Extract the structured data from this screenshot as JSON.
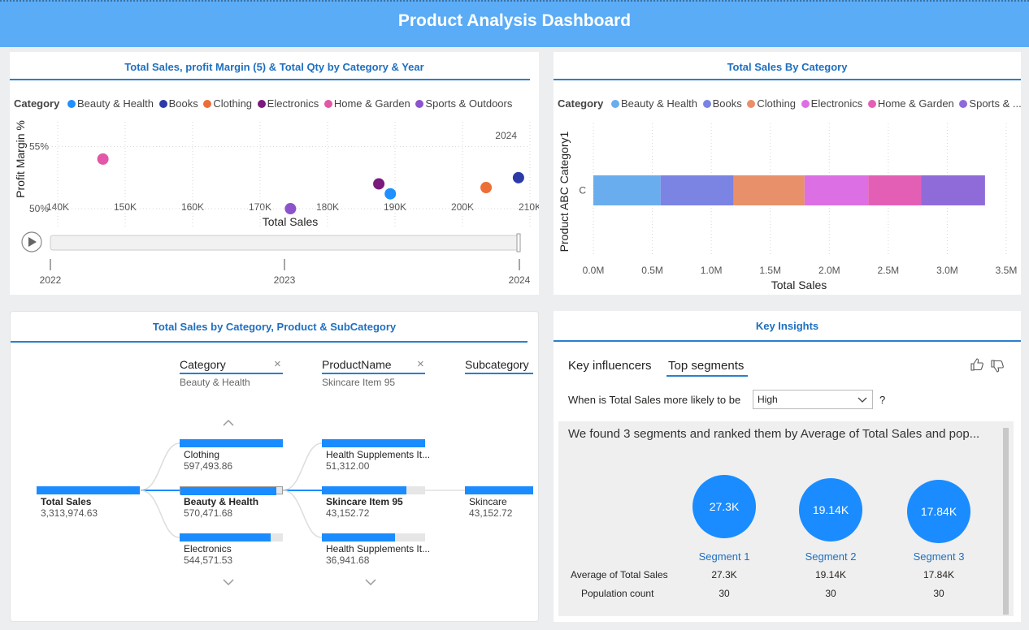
{
  "dashboard": {
    "title": "Product Analysis Dashboard"
  },
  "colors": {
    "header": "#5aacf7",
    "accent": "#1a8cff",
    "beauty_health": "#6aadee",
    "books": "#7b83e3",
    "clothing": "#e8906a",
    "electronics": "#dc6fe3",
    "home_garden": "#e35fb5",
    "sports_outdoors": "#8f6bda",
    "scatter_beauty": "#1e90ff",
    "scatter_books": "#2c3aa8",
    "scatter_clothing": "#ec6f37",
    "scatter_electronics": "#7b1a7d",
    "scatter_home": "#e357a8",
    "scatter_sports": "#8c53cc"
  },
  "scatter_panel": {
    "title": "Total Sales, profit Margin (5) & Total Qty by Category & Year",
    "legend_title": "Category",
    "legend": [
      {
        "label": "Beauty & Health",
        "color": "#1e90ff"
      },
      {
        "label": "Books",
        "color": "#2c3aa8"
      },
      {
        "label": "Clothing",
        "color": "#ec6f37"
      },
      {
        "label": "Electronics",
        "color": "#7b1a7d"
      },
      {
        "label": "Home & Garden",
        "color": "#e357a8"
      },
      {
        "label": "Sports & Outdoors",
        "color": "#8c53cc"
      }
    ],
    "play_axis": {
      "years": [
        "2022",
        "2023",
        "2024"
      ],
      "current": "2024"
    }
  },
  "bar_panel": {
    "title": "Total Sales By Category",
    "legend_title": "Category",
    "legend": [
      {
        "label": "Beauty & Health",
        "color": "#6aadee"
      },
      {
        "label": "Books",
        "color": "#7b83e3"
      },
      {
        "label": "Clothing",
        "color": "#e8906a"
      },
      {
        "label": "Electronics",
        "color": "#dc6fe3"
      },
      {
        "label": "Home & Garden",
        "color": "#e35fb5"
      },
      {
        "label": "Sports & ...",
        "color": "#8f6bda"
      }
    ]
  },
  "chart_data": [
    {
      "type": "scatter",
      "title": "",
      "frame_label": "2024",
      "xlabel": "Total Sales",
      "ylabel": "Profit Margin %",
      "xlim": [
        140000,
        210000
      ],
      "ylim": [
        48.5,
        57
      ],
      "x_ticks": [
        "140K",
        "150K",
        "160K",
        "170K",
        "180K",
        "190K",
        "200K",
        "210K"
      ],
      "x_tick_values": [
        140000,
        150000,
        160000,
        170000,
        180000,
        190000,
        200000,
        210000
      ],
      "y_ticks": [
        "50%",
        "55%"
      ],
      "y_tick_values": [
        50,
        55
      ],
      "series": [
        {
          "name": "Home & Garden",
          "x": 146700,
          "y": 54.0,
          "color": "#e357a8"
        },
        {
          "name": "Sports & Outdoors",
          "x": 174500,
          "y": 50.0,
          "color": "#8c53cc"
        },
        {
          "name": "Electronics",
          "x": 187600,
          "y": 52.0,
          "color": "#7b1a7d"
        },
        {
          "name": "Beauty & Health",
          "x": 189300,
          "y": 51.2,
          "color": "#1e90ff"
        },
        {
          "name": "Clothing",
          "x": 203500,
          "y": 51.7,
          "color": "#ec6f37"
        },
        {
          "name": "Books",
          "x": 208300,
          "y": 52.5,
          "color": "#2c3aa8"
        }
      ]
    },
    {
      "type": "bar",
      "orientation": "horizontal",
      "stacked": true,
      "title": "",
      "xlabel": "Total Sales",
      "ylabel": "Product ABC Category1",
      "categories": [
        "C"
      ],
      "xlim": [
        0,
        3.5
      ],
      "x_ticks": [
        "0.0M",
        "0.5M",
        "1.0M",
        "1.5M",
        "2.0M",
        "2.5M",
        "3.0M",
        "3.5M"
      ],
      "x_tick_values": [
        0,
        0.5,
        1.0,
        1.5,
        2.0,
        2.5,
        3.0,
        3.5
      ],
      "unit": "M",
      "series": [
        {
          "name": "Beauty & Health",
          "values": [
            0.57
          ],
          "color": "#6aadee"
        },
        {
          "name": "Books",
          "values": [
            0.62
          ],
          "color": "#7b83e3"
        },
        {
          "name": "Clothing",
          "values": [
            0.6
          ],
          "color": "#e8906a"
        },
        {
          "name": "Electronics",
          "values": [
            0.54
          ],
          "color": "#dc6fe3"
        },
        {
          "name": "Home & Garden",
          "values": [
            0.45
          ],
          "color": "#e35fb5"
        },
        {
          "name": "Sports & ...",
          "values": [
            0.54
          ],
          "color": "#8f6bda"
        }
      ]
    }
  ],
  "decomp_panel": {
    "title": "Total Sales by Category, Product & SubCategory",
    "columns": [
      {
        "title": "Category",
        "sub": "Beauty & Health",
        "close": "×"
      },
      {
        "title": "ProductName",
        "sub": "Skincare Item 95",
        "close": "×"
      },
      {
        "title": "Subcategory",
        "sub": ""
      }
    ],
    "root": {
      "label": "Total Sales",
      "value": "3,313,974.63",
      "fill": 1.0
    },
    "col1": [
      {
        "label": "Clothing",
        "value": "597,493.86",
        "fill": 1.0
      },
      {
        "label": "Beauty & Health",
        "value": "570,471.68",
        "fill": 0.94
      },
      {
        "label": "Electronics",
        "value": "544,571.53",
        "fill": 0.88
      }
    ],
    "col2": [
      {
        "label": "Health Supplements It...",
        "value": "51,312.00",
        "fill": 1.0
      },
      {
        "label": "Skincare Item 95",
        "value": "43,152.72",
        "fill": 0.82
      },
      {
        "label": "Health Supplements It...",
        "value": "36,941.68",
        "fill": 0.71
      }
    ],
    "col3": [
      {
        "label": "Skincare",
        "value": "43,152.72",
        "fill": 1.0
      }
    ]
  },
  "insights_panel": {
    "title": "Key Insights",
    "tabs": [
      "Key influencers",
      "Top segments"
    ],
    "question": "When is Total Sales more likely to be",
    "dropdown_value": "High",
    "question_mark": "?",
    "summary": "We found 3 segments and ranked them by Average of Total Sales and pop...",
    "row_labels": [
      "Average of Total Sales",
      "Population count"
    ],
    "segments": [
      {
        "name": "Segment 1",
        "circle": "27.3K",
        "avg": "27.3K",
        "count": "30"
      },
      {
        "name": "Segment 2",
        "circle": "19.14K",
        "avg": "19.14K",
        "count": "30"
      },
      {
        "name": "Segment 3",
        "circle": "17.84K",
        "avg": "17.84K",
        "count": "30"
      }
    ]
  }
}
